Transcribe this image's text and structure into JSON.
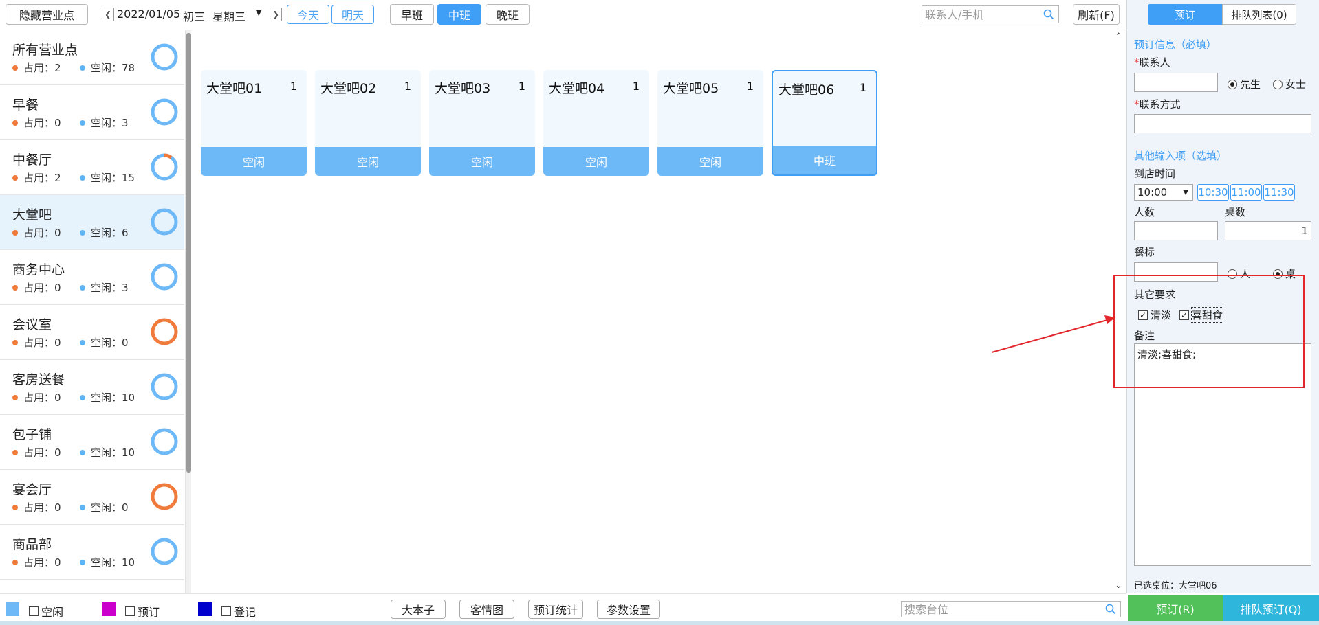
{
  "toolbar": {
    "hide_outlets": "隐藏营业点",
    "date": "2022/01/05",
    "lunar": "初三",
    "weekday": "星期三",
    "today": "今天",
    "tomorrow": "明天",
    "shifts": [
      "早班",
      "中班",
      "晚班"
    ],
    "active_shift": "中班",
    "search_placeholder": "联系人/手机",
    "refresh": "刷新(F)"
  },
  "sidebar": {
    "occupied_label": "占用：",
    "free_label": "空闲：",
    "items": [
      {
        "name": "所有营业点",
        "occupied": "2",
        "free": "78",
        "ring": "blue",
        "active": false
      },
      {
        "name": "早餐",
        "occupied": "0",
        "free": "3",
        "ring": "blue",
        "active": false
      },
      {
        "name": "中餐厅",
        "occupied": "2",
        "free": "15",
        "ring": "blue-part",
        "active": false
      },
      {
        "name": "大堂吧",
        "occupied": "0",
        "free": "6",
        "ring": "blue",
        "active": true
      },
      {
        "name": "商务中心",
        "occupied": "0",
        "free": "3",
        "ring": "blue",
        "active": false
      },
      {
        "name": "会议室",
        "occupied": "0",
        "free": "0",
        "ring": "orange",
        "active": false
      },
      {
        "name": "客房送餐",
        "occupied": "0",
        "free": "10",
        "ring": "blue",
        "active": false
      },
      {
        "name": "包子铺",
        "occupied": "0",
        "free": "10",
        "ring": "blue",
        "active": false
      },
      {
        "name": "宴会厅",
        "occupied": "0",
        "free": "0",
        "ring": "orange",
        "active": false
      },
      {
        "name": "商品部",
        "occupied": "0",
        "free": "10",
        "ring": "blue",
        "active": false
      }
    ]
  },
  "tables": [
    {
      "name": "大堂吧01",
      "count": "1",
      "status": "空闲",
      "selected": false
    },
    {
      "name": "大堂吧02",
      "count": "1",
      "status": "空闲",
      "selected": false
    },
    {
      "name": "大堂吧03",
      "count": "1",
      "status": "空闲",
      "selected": false
    },
    {
      "name": "大堂吧04",
      "count": "1",
      "status": "空闲",
      "selected": false
    },
    {
      "name": "大堂吧05",
      "count": "1",
      "status": "空闲",
      "selected": false
    },
    {
      "name": "大堂吧06",
      "count": "1",
      "status": "中班",
      "selected": true
    }
  ],
  "right_panel": {
    "tab_reserve": "预订",
    "tab_queue": "排队列表(0)",
    "section_required": "预订信息（必填）",
    "contact_label": "联系人",
    "salutation_mr": "先生",
    "salutation_ms": "女士",
    "contact_method_label": "联系方式",
    "section_optional": "其他输入项（选填）",
    "arrival_time_label": "到店时间",
    "arrival_time_value": "10:00",
    "time_chips": [
      "10:30",
      "11:00",
      "11:30"
    ],
    "people_label": "人数",
    "tables_label": "桌数",
    "tables_value": "1",
    "meal_label": "餐标",
    "per_person": "人",
    "per_table": "桌",
    "other_req_label": "其它要求",
    "req_options": [
      "清淡",
      "喜甜食"
    ],
    "remark_label": "备注",
    "remark_value": "清淡;喜甜食;",
    "selected_table": "已选桌位：大堂吧06",
    "btn_reserve": "预订(R)",
    "btn_queue": "排队预订(Q)"
  },
  "bottom": {
    "legend": [
      {
        "label": "空闲",
        "color": "#6db8f6"
      },
      {
        "label": "预订",
        "color": "#cc00cc"
      },
      {
        "label": "登记",
        "color": "#0000cc"
      }
    ],
    "buttons": [
      "大本子",
      "客情图",
      "预订统计",
      "参数设置"
    ],
    "search_placeholder": "搜索台位"
  },
  "colors": {
    "accent": "#3f9ef5",
    "idle": "#6db8f6",
    "occupied": "#f07a3b",
    "reserve_btn": "#52c15a",
    "queue_btn": "#2fb6dd",
    "annotation": "#e3262b"
  }
}
